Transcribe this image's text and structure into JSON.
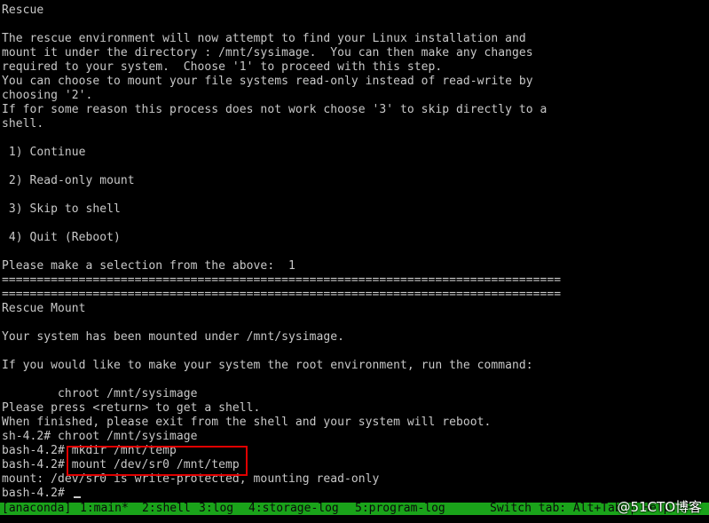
{
  "terminal": {
    "lines": [
      "Rescue",
      "",
      "The rescue environment will now attempt to find your Linux installation and",
      "mount it under the directory : /mnt/sysimage.  You can then make any changes",
      "required to your system.  Choose '1' to proceed with this step.",
      "You can choose to mount your file systems read-only instead of read-write by",
      "choosing '2'.",
      "If for some reason this process does not work choose '3' to skip directly to a",
      "shell.",
      "",
      " 1) Continue",
      "",
      " 2) Read-only mount",
      "",
      " 3) Skip to shell",
      "",
      " 4) Quit (Reboot)",
      "",
      "Please make a selection from the above:  1",
      "================================================================================",
      "================================================================================",
      "Rescue Mount",
      "",
      "Your system has been mounted under /mnt/sysimage.",
      "",
      "If you would like to make your system the root environment, run the command:",
      "",
      "        chroot /mnt/sysimage",
      "Please press <return> to get a shell.",
      "When finished, please exit from the shell and your system will reboot.",
      "sh-4.2# chroot /mnt/sysimage",
      "bash-4.2# mkdir /mnt/temp",
      "bash-4.2# mount /dev/sr0 /mnt/temp",
      "mount: /dev/sr0 is write-protected, mounting read-only",
      "bash-4.2# "
    ]
  },
  "tmux": {
    "session": "[anaconda]",
    "windows": [
      {
        "label": "1:main*"
      },
      {
        "label": "2:shell"
      },
      {
        "label": "3:log"
      },
      {
        "label": "4:storage-log"
      },
      {
        "label": "5:program-log"
      }
    ],
    "switch_hint": "Switch tab: Alt+Tab | Help: F1"
  },
  "watermark": "@51CTO博客",
  "colors": {
    "background": "#000000",
    "text": "#c8c8c8",
    "status_bar": "#1aa31a",
    "highlight_border": "#e00000"
  }
}
